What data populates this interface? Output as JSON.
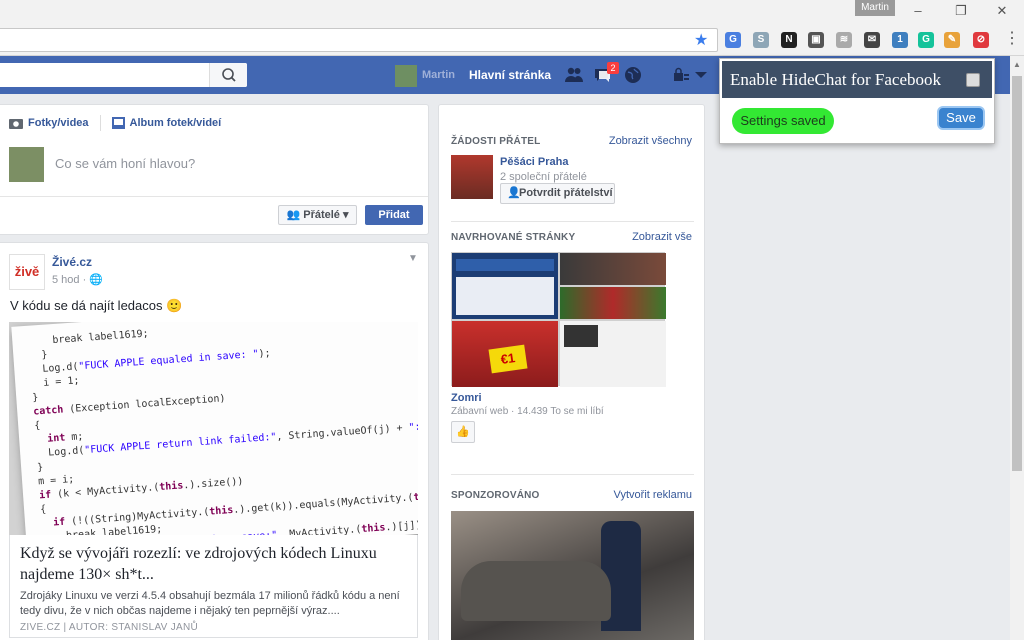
{
  "window": {
    "user": "Martin",
    "minimize": "–",
    "restore": "❐",
    "close": "✕"
  },
  "toolbar": {
    "bookmark_icon": "★",
    "menu_icon": "⋮",
    "extensions": [
      {
        "name": "translate-icon",
        "color": "#4a7fe0",
        "glyph": "G"
      },
      {
        "name": "skype-icon",
        "color": "#8ea6b6",
        "glyph": "S"
      },
      {
        "name": "notion-icon",
        "color": "#222222",
        "glyph": "N"
      },
      {
        "name": "folder-icon",
        "color": "#555555",
        "glyph": "▣"
      },
      {
        "name": "rss-icon",
        "color": "#aaaaaa",
        "glyph": "≋"
      },
      {
        "name": "mail-icon",
        "color": "#444444",
        "glyph": "✉"
      },
      {
        "name": "mailbox-icon",
        "color": "#3f7fbf",
        "glyph": "1"
      },
      {
        "name": "grammarly-icon",
        "color": "#15c39a",
        "glyph": "G"
      },
      {
        "name": "pencil-icon",
        "color": "#e8a23a",
        "glyph": "✎"
      },
      {
        "name": "hidechat-icon",
        "color": "#e0393e",
        "glyph": "⊘"
      }
    ]
  },
  "fb": {
    "username": "Martin",
    "home": "Hlavní stránka",
    "messages_badge": "2",
    "search_icon": "⚲"
  },
  "composer": {
    "tab_photos": "Fotky/videa",
    "tab_album": "Album fotek/videí",
    "placeholder": "Co se vám honí hlavou?",
    "audience": "Přátelé",
    "post": "Přidat"
  },
  "post": {
    "logo": "živě",
    "author": "Živé.cz",
    "time": "5 hod",
    "text": "V kódu se dá najít ledacos 🙂",
    "link_title": "Když se vývojáři rozezlí: ve zdrojových kódech Linuxu najdeme 130× sh*t...",
    "link_desc": "Zdrojáky Linuxu ve verzi 4.5.4 obsahují bezmála 17 milionů řádků kódu a není tedy divu, že v nich občas najdeme i nějaký ten peprnější výraz....",
    "link_source": "ZIVE.CZ  |  AUTOR: STANISLAV JANŮ"
  },
  "right": {
    "friend_requests_title": "ŽÁDOSTI PŘÁTEL",
    "friend_requests_link": "Zobrazit všechny",
    "friend_name": "Pěšáci Praha",
    "friend_mutual": "2 společní přátelé",
    "friend_confirm": "Potvrdit přátelství",
    "suggested_title": "NAVRHOVANÉ STRÁNKY",
    "suggested_link": "Zobrazit vše",
    "page_name": "Zomri",
    "page_meta": "Zábavní web · 14.439 To se mi líbí",
    "like_icon": "👍",
    "sponsored_title": "SPONZOROVÁNO",
    "sponsored_link": "Vytvořit reklamu"
  },
  "popup": {
    "title": "Enable HideChat for Facebook",
    "status": "Settings saved",
    "save": "Save"
  }
}
